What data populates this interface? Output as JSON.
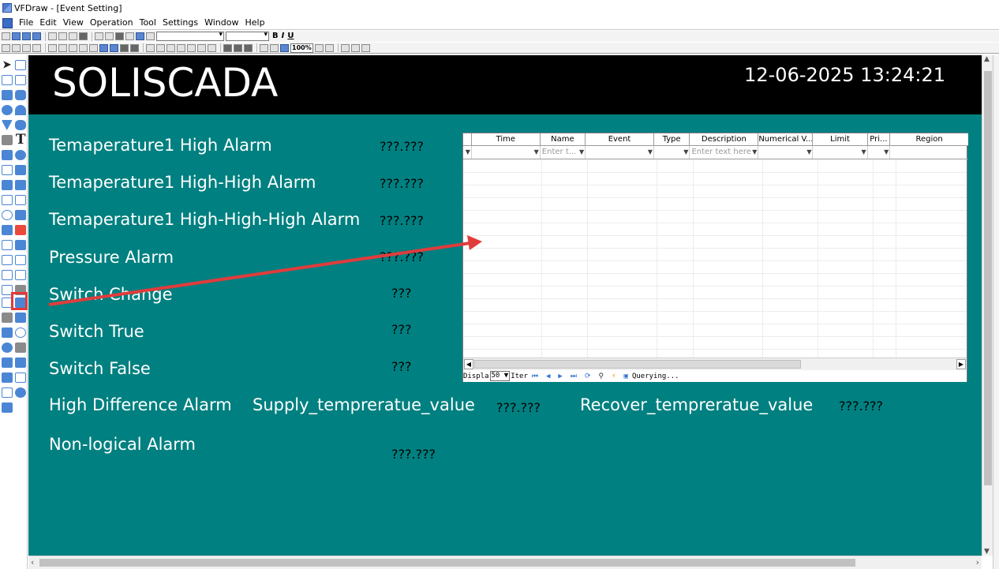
{
  "window": {
    "title": "VFDraw - [Event Setting]"
  },
  "menu": [
    "File",
    "Edit",
    "View",
    "Operation",
    "Tool",
    "Settings",
    "Window",
    "Help"
  ],
  "toolbar": {
    "bold": "B",
    "italic": "I",
    "underline": "U",
    "zoom": "100%"
  },
  "canvas": {
    "brand": "SOLISCADA",
    "datetime": "12-06-2025 13:24:21",
    "background_color": "#008080",
    "header_color": "#000000"
  },
  "alarms": [
    {
      "label": "Temaperature1 High Alarm",
      "value": "???.???"
    },
    {
      "label": "Temaperature1 High-High Alarm",
      "value": "???.???"
    },
    {
      "label": "Temaperature1 High-High-High Alarm",
      "value": "???.???"
    },
    {
      "label": "Pressure Alarm",
      "value": "???.???"
    },
    {
      "label": "Switch Change",
      "value": "???"
    },
    {
      "label": "Switch True",
      "value": "???"
    },
    {
      "label": "Switch False",
      "value": "???"
    }
  ],
  "difference_alarm": {
    "label": "High Difference Alarm",
    "supply_label": "Supply_tempreratue_value",
    "supply_value": "???.???",
    "recover_label": "Recover_tempreratue_value",
    "recover_value": "???.???"
  },
  "non_logical_alarm": {
    "label": "Non-logical Alarm",
    "value": "???.???"
  },
  "grid": {
    "columns": [
      "Time",
      "Name",
      "Event",
      "Type",
      "Description",
      "Numerical V...",
      "Limit",
      "Pri...",
      "Region"
    ],
    "filter_placeholders": [
      "",
      "Enter t...",
      "",
      "",
      "Enter text here",
      "",
      "",
      "",
      ""
    ],
    "status": {
      "display_label": "Displa",
      "page_size": "50",
      "items_label": "Iter",
      "querying": "Querying..."
    }
  },
  "annotation": {
    "arrow_color": "#e03c3c",
    "highlight_color": "#e53939"
  }
}
